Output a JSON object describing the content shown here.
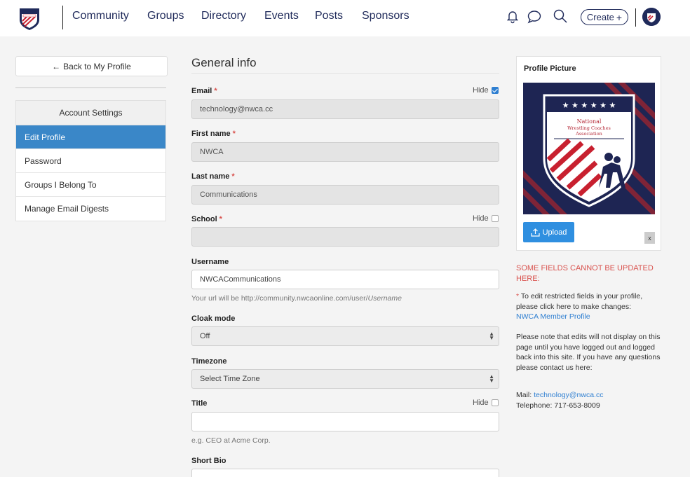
{
  "nav": {
    "links": [
      "Community",
      "Groups",
      "Directory",
      "Events",
      "Posts",
      "Sponsors"
    ],
    "create_label": "Create",
    "create_glyph": "+"
  },
  "sidebar": {
    "back_arrow": "←",
    "back_label": "Back to My Profile",
    "section_title": "Account Settings",
    "items": [
      {
        "label": "Edit Profile",
        "active": true
      },
      {
        "label": "Password",
        "active": false
      },
      {
        "label": "Groups I Belong To",
        "active": false
      },
      {
        "label": "Manage Email Digests",
        "active": false
      }
    ]
  },
  "form": {
    "title": "General info",
    "hide_label": "Hide",
    "required_mark": "*",
    "email": {
      "label": "Email",
      "value": "technology@nwca.cc",
      "hidden": true
    },
    "first_name": {
      "label": "First name",
      "value": "NWCA"
    },
    "last_name": {
      "label": "Last name",
      "value": "Communications"
    },
    "school": {
      "label": "School",
      "value": "",
      "hidden": false
    },
    "username": {
      "label": "Username",
      "value": "NWCACommunications",
      "help_prefix": "Your url will be http://community.nwcaonline.com/user/",
      "help_var": "Username"
    },
    "cloak_mode": {
      "label": "Cloak mode",
      "selected": "Off"
    },
    "timezone": {
      "label": "Timezone",
      "selected": "Select Time Zone"
    },
    "title_field": {
      "label": "Title",
      "value": "",
      "hidden": false,
      "help": "e.g. CEO at Acme Corp."
    },
    "short_bio": {
      "label": "Short Bio"
    }
  },
  "profile_picture": {
    "title": "Profile Picture",
    "upload_label": "Upload",
    "remove_label": "x",
    "logo_text": [
      "National",
      "Wrestling Coaches",
      "Association"
    ]
  },
  "notice": {
    "warning": "SOME FIELDS CANNOT BE UPDATED HERE:",
    "star": "*",
    "edit_text": "To edit restricted fields in your profile, please click here to make changes:",
    "edit_link": "NWCA Member Profile",
    "note": "Please note that edits will not display on this page until you have logged out and logged back into this site. If you have any questions please contact us here:",
    "mail_label": "Mail:",
    "mail_value": "technology@nwca.cc",
    "phone_label": "Telephone:",
    "phone_value": "717-653-8009"
  },
  "colors": {
    "accent": "#3a87c8",
    "brand_navy": "#1f2a5a",
    "required": "#d9534f",
    "upload": "#2f8fe0"
  }
}
